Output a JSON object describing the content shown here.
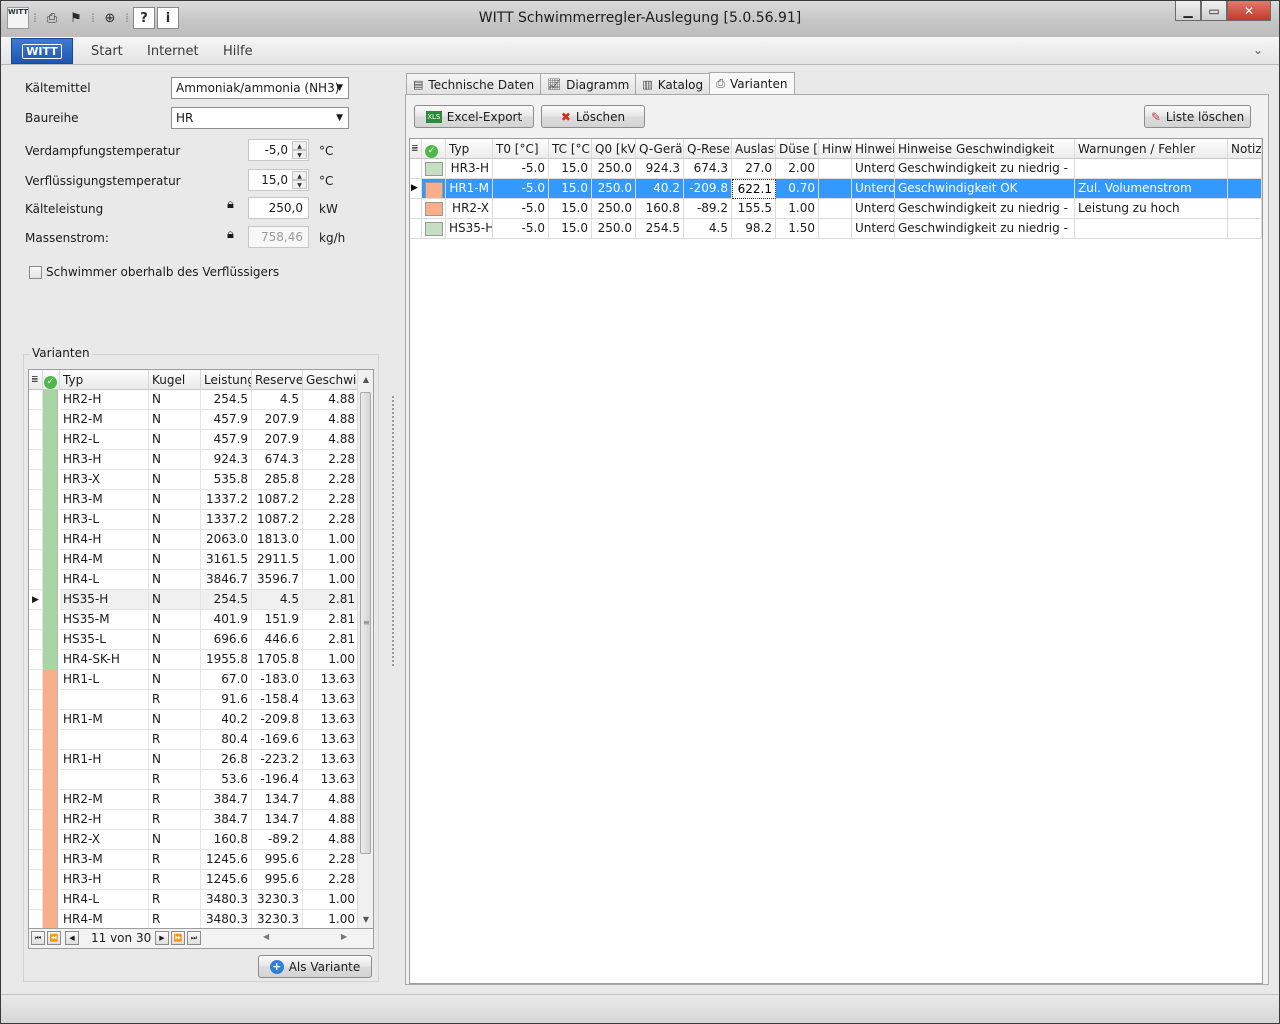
{
  "window": {
    "title": "WITT Schwimmerregler-Auslegung [5.0.56.91]"
  },
  "quick_access": {
    "logo_text": "WITT",
    "icons": [
      "print-icon",
      "flag-icon",
      "globe-icon",
      "help-icon",
      "info-icon"
    ]
  },
  "ribbon": {
    "app_button_label": "WITT",
    "tabs": [
      "Start",
      "Internet",
      "Hilfe"
    ]
  },
  "form": {
    "refrigerant_label": "Kältemittel",
    "refrigerant_value": "Ammoniak/ammonia (NH3)",
    "series_label": "Baureihe",
    "series_value": "HR",
    "evap_label": "Verdampfungstemperatur",
    "evap_value": "-5,0",
    "evap_unit": "°C",
    "cond_label": "Verflüssigungstemperatur",
    "cond_value": "15,0",
    "cond_unit": "°C",
    "capacity_label": "Kälteleistung",
    "capacity_value": "250,0",
    "capacity_unit": "kW",
    "massflow_label": "Massenstrom:",
    "massflow_value": "758,46",
    "massflow_unit": "kg/h",
    "float_checkbox_label": "Schwimmer oberhalb des Verflüssigers",
    "float_checkbox_checked": false
  },
  "variants_group": {
    "label": "Varianten",
    "columns": [
      "Typ",
      "Kugel",
      "Leistung",
      "Reserve",
      "Geschwi"
    ],
    "rows": [
      {
        "typ": "HR2-H",
        "kugel": "N",
        "leistung": "254.5",
        "reserve": "4.5",
        "geschw": "4.88",
        "group": "ok"
      },
      {
        "typ": "HR2-M",
        "kugel": "N",
        "leistung": "457.9",
        "reserve": "207.9",
        "geschw": "4.88",
        "group": "ok"
      },
      {
        "typ": "HR2-L",
        "kugel": "N",
        "leistung": "457.9",
        "reserve": "207.9",
        "geschw": "4.88",
        "group": "ok"
      },
      {
        "typ": "HR3-H",
        "kugel": "N",
        "leistung": "924.3",
        "reserve": "674.3",
        "geschw": "2.28",
        "group": "ok"
      },
      {
        "typ": "HR3-X",
        "kugel": "N",
        "leistung": "535.8",
        "reserve": "285.8",
        "geschw": "2.28",
        "group": "ok"
      },
      {
        "typ": "HR3-M",
        "kugel": "N",
        "leistung": "1337.2",
        "reserve": "1087.2",
        "geschw": "2.28",
        "group": "ok"
      },
      {
        "typ": "HR3-L",
        "kugel": "N",
        "leistung": "1337.2",
        "reserve": "1087.2",
        "geschw": "2.28",
        "group": "ok"
      },
      {
        "typ": "HR4-H",
        "kugel": "N",
        "leistung": "2063.0",
        "reserve": "1813.0",
        "geschw": "1.00",
        "group": "ok"
      },
      {
        "typ": "HR4-M",
        "kugel": "N",
        "leistung": "3161.5",
        "reserve": "2911.5",
        "geschw": "1.00",
        "group": "ok"
      },
      {
        "typ": "HR4-L",
        "kugel": "N",
        "leistung": "3846.7",
        "reserve": "3596.7",
        "geschw": "1.00",
        "group": "ok"
      },
      {
        "typ": "HS35-H",
        "kugel": "N",
        "leistung": "254.5",
        "reserve": "4.5",
        "geschw": "2.81",
        "group": "ok",
        "current": true
      },
      {
        "typ": "HS35-M",
        "kugel": "N",
        "leistung": "401.9",
        "reserve": "151.9",
        "geschw": "2.81",
        "group": "ok"
      },
      {
        "typ": "HS35-L",
        "kugel": "N",
        "leistung": "696.6",
        "reserve": "446.6",
        "geschw": "2.81",
        "group": "ok"
      },
      {
        "typ": "HR4-SK-H",
        "kugel": "N",
        "leistung": "1955.8",
        "reserve": "1705.8",
        "geschw": "1.00",
        "group": "ok"
      },
      {
        "typ": "HR1-L",
        "kugel": "N",
        "leistung": "67.0",
        "reserve": "-183.0",
        "geschw": "13.63",
        "group": "warn"
      },
      {
        "typ": "",
        "kugel": "R",
        "leistung": "91.6",
        "reserve": "-158.4",
        "geschw": "13.63",
        "group": "warn"
      },
      {
        "typ": "HR1-M",
        "kugel": "N",
        "leistung": "40.2",
        "reserve": "-209.8",
        "geschw": "13.63",
        "group": "warn"
      },
      {
        "typ": "",
        "kugel": "R",
        "leistung": "80.4",
        "reserve": "-169.6",
        "geschw": "13.63",
        "group": "warn"
      },
      {
        "typ": "HR1-H",
        "kugel": "N",
        "leistung": "26.8",
        "reserve": "-223.2",
        "geschw": "13.63",
        "group": "warn"
      },
      {
        "typ": "",
        "kugel": "R",
        "leistung": "53.6",
        "reserve": "-196.4",
        "geschw": "13.63",
        "group": "warn"
      },
      {
        "typ": "HR2-M",
        "kugel": "R",
        "leistung": "384.7",
        "reserve": "134.7",
        "geschw": "4.88",
        "group": "warn"
      },
      {
        "typ": "HR2-H",
        "kugel": "R",
        "leistung": "384.7",
        "reserve": "134.7",
        "geschw": "4.88",
        "group": "warn"
      },
      {
        "typ": "HR2-X",
        "kugel": "N",
        "leistung": "160.8",
        "reserve": "-89.2",
        "geschw": "4.88",
        "group": "warn"
      },
      {
        "typ": "HR3-M",
        "kugel": "R",
        "leistung": "1245.6",
        "reserve": "995.6",
        "geschw": "2.28",
        "group": "warn"
      },
      {
        "typ": "HR3-H",
        "kugel": "R",
        "leistung": "1245.6",
        "reserve": "995.6",
        "geschw": "2.28",
        "group": "warn"
      },
      {
        "typ": "HR4-L",
        "kugel": "R",
        "leistung": "3480.3",
        "reserve": "3230.3",
        "geschw": "1.00",
        "group": "warn"
      },
      {
        "typ": "HR4-M",
        "kugel": "R",
        "leistung": "3480.3",
        "reserve": "3230.3",
        "geschw": "1.00",
        "group": "warn"
      }
    ],
    "navigator_text": "11 von 30",
    "add_variant_label": "Als Variante"
  },
  "tabs": [
    {
      "label": "Technische Daten",
      "icon": "table-icon"
    },
    {
      "label": "Diagramm",
      "icon": "chart-icon"
    },
    {
      "label": "Katalog",
      "icon": "catalog-icon"
    },
    {
      "label": "Varianten",
      "icon": "printer-icon",
      "active": true
    }
  ],
  "toolbar": {
    "excel_label": "Excel-Export",
    "delete_label": "Löschen",
    "clear_list_label": "Liste löschen"
  },
  "results": {
    "columns": [
      "Typ",
      "T0 [°C]",
      "TC [°C",
      "Q0 [kV",
      "Q-Gerät",
      "Q-Reser",
      "Auslast",
      "Düse [",
      "Hinw",
      "Hinwei",
      "Hinweise Geschwindigkeit",
      "Warnungen / Fehler",
      "Notiz"
    ],
    "rows": [
      {
        "color": "#c6dfc4",
        "typ": "HR3-H",
        "t0": "-5.0",
        "tc": "15.0",
        "q0": "250.0",
        "qgeraet": "924.3",
        "qreserve": "674.3",
        "auslast": "27.0",
        "duese": "2.00",
        "hinw": "",
        "hinwei": "Unterd",
        "geschw": "Geschwindigkeit zu niedrig -",
        "warn": "",
        "notiz": ""
      },
      {
        "color": "#f8ae8a",
        "typ": "HR1-M",
        "t0": "-5.0",
        "tc": "15.0",
        "q0": "250.0",
        "qgeraet": "40.2",
        "qreserve": "-209.8",
        "auslast": "622.1",
        "duese": "0.70",
        "hinw": "",
        "hinwei": "Unterd",
        "geschw": "Geschwindigkeit OK",
        "warn": "Zul. Volumenstrom",
        "notiz": "",
        "selected": true
      },
      {
        "color": "#f8ae8a",
        "typ": "HR2-X",
        "t0": "-5.0",
        "tc": "15.0",
        "q0": "250.0",
        "qgeraet": "160.8",
        "qreserve": "-89.2",
        "auslast": "155.5",
        "duese": "1.00",
        "hinw": "",
        "hinwei": "Unterd",
        "geschw": "Geschwindigkeit zu niedrig -",
        "warn": "Leistung zu hoch",
        "notiz": ""
      },
      {
        "color": "#c6dfc4",
        "typ": "HS35-H",
        "t0": "-5.0",
        "tc": "15.0",
        "q0": "250.0",
        "qgeraet": "254.5",
        "qreserve": "4.5",
        "auslast": "98.2",
        "duese": "1.50",
        "hinw": "",
        "hinwei": "Unterd",
        "geschw": "Geschwindigkeit zu niedrig -",
        "warn": "",
        "notiz": ""
      }
    ]
  },
  "colors": {
    "ok_group": "#a9d5a5",
    "warn_group": "#f8ae8a",
    "selection": "#3399ff",
    "app_button": "#2a66c2"
  }
}
